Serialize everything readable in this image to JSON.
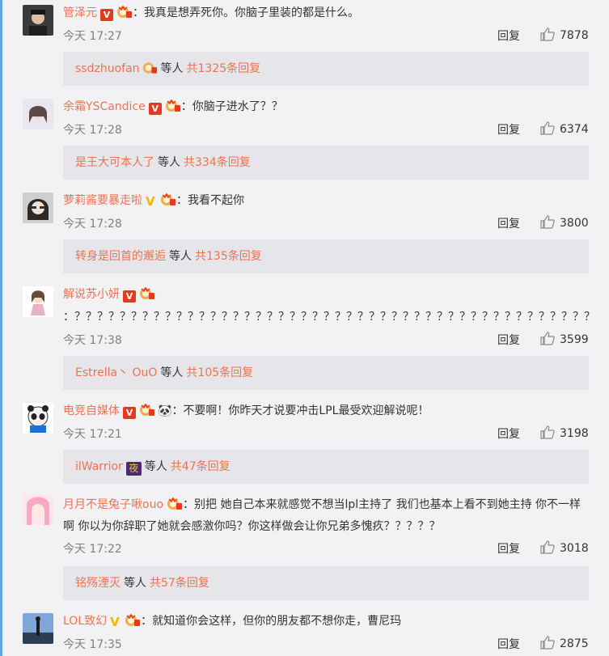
{
  "comments": [
    {
      "user": "管泽元",
      "text": "：我真是想弄死你。你脑子里装的都是什么。",
      "time": "今天 17:27",
      "reply_label": "回复",
      "likes": "7878",
      "sub_user": "ssdzhuofan",
      "sub_etc": "等人",
      "sub_count": "共1325条回复"
    },
    {
      "user": "余霜YSCandice",
      "text": "：你脑子进水了？？",
      "time": "今天 17:28",
      "reply_label": "回复",
      "likes": "6374",
      "sub_user": "是王大可本人了",
      "sub_etc": "等人",
      "sub_count": "共334条回复"
    },
    {
      "user": "萝莉酱要暴走啦",
      "text": "：我看不起你",
      "time": "今天 17:28",
      "reply_label": "回复",
      "likes": "3800",
      "sub_user": "转身是回首的邂逅",
      "sub_etc": "等人",
      "sub_count": "共135条回复"
    },
    {
      "user": "解说苏小妍",
      "text": "：？？？？？？？？？？？？？？？？？？？？？？？？？？？？？？？？？？？？？？？？？？？？？？",
      "time": "今天 17:38",
      "reply_label": "回复",
      "likes": "3599",
      "sub_user": "Estrella丶 OuO",
      "sub_etc": "等人",
      "sub_count": "共105条回复"
    },
    {
      "user": "电竞自媒体",
      "text": "：不要啊！你昨天才说要冲击LPL最受欢迎解说呢！",
      "time": "今天 17:21",
      "reply_label": "回复",
      "likes": "3198",
      "sub_user": "ilWarrior",
      "sub_etc": "等人",
      "sub_count": "共47条回复"
    },
    {
      "user": "月月不是兔子啾ouo",
      "text": "：别把 她自己本来就感觉不想当lpl主持了 我们也基本上看不到她主持 你不一样啊 你以为你辞职了她就会感激你吗？你这样做会让你兄弟多愧疚？？？？？",
      "time": "今天 17:22",
      "reply_label": "回复",
      "likes": "3018",
      "sub_user": "铭殇湮灭",
      "sub_etc": "等人",
      "sub_count": "共57条回复"
    },
    {
      "user": "LOL致幻",
      "text": "：就知道你会这样，但你的朋友都不想你走，曹尼玛",
      "time": "今天 17:35",
      "reply_label": "回复",
      "likes": "2875"
    }
  ],
  "badge_v_label": "V",
  "panda_emoji": "🐼",
  "night_badge": "夜",
  "colors": {
    "username": "#eb7350",
    "background": "#f2f2f5",
    "subpanel": "#e6e6ea",
    "accent_left": "#5ea6e6"
  },
  "icons": [
    "thumbs-up-icon",
    "verified-v-icon",
    "vip-crown-icon"
  ]
}
